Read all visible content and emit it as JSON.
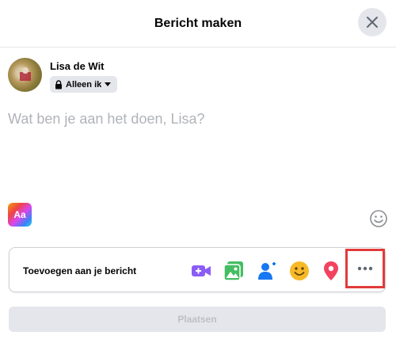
{
  "header": {
    "title": "Bericht maken"
  },
  "user": {
    "name": "Lisa de Wit",
    "audience": "Alleen ik"
  },
  "composer": {
    "placeholder": "Wat ben je aan het doen, Lisa?"
  },
  "background_button": {
    "label": "Aa"
  },
  "add_bar": {
    "label": "Toevoegen aan je bericht",
    "icons": [
      "video-icon",
      "photo-icon",
      "tag-people-icon",
      "feeling-icon",
      "location-icon",
      "more-icon"
    ]
  },
  "post_button": {
    "label": "Plaatsen"
  },
  "colors": {
    "video": "#8b5cf6",
    "photo": "#45bd62",
    "tag": "#1877f2",
    "feeling": "#f7b928",
    "location": "#f3425f",
    "highlight": "#e23a3a"
  }
}
